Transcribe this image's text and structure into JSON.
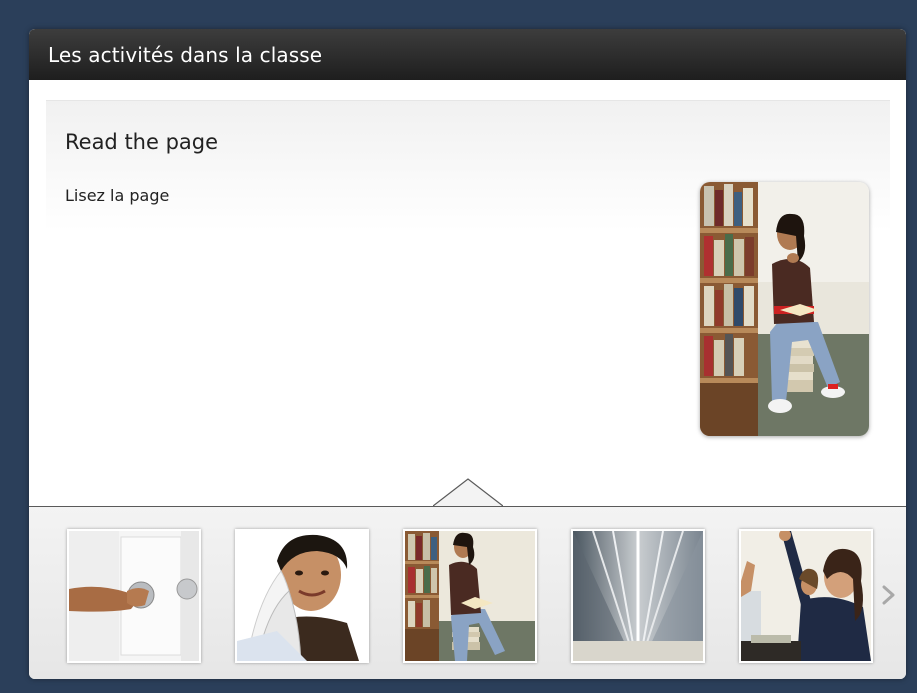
{
  "window": {
    "title": "Les activités dans la classe"
  },
  "activity": {
    "heading": "Read the page",
    "instruction": "Lisez la page",
    "image_icon": "student-reading-photo"
  },
  "thumbnails": [
    {
      "icon": "door-knob-photo"
    },
    {
      "icon": "student-flipping-pages-photo"
    },
    {
      "icon": "student-reading-photo"
    },
    {
      "icon": "open-book-pages-photo"
    },
    {
      "icon": "students-raising-hands-photo"
    }
  ],
  "thumbstrip": {
    "next_icon": "chevron-right-icon"
  },
  "colors": {
    "page_background": "#2b3f5a",
    "titlebar": "#2a2a2a",
    "title_text": "#ffffff"
  }
}
